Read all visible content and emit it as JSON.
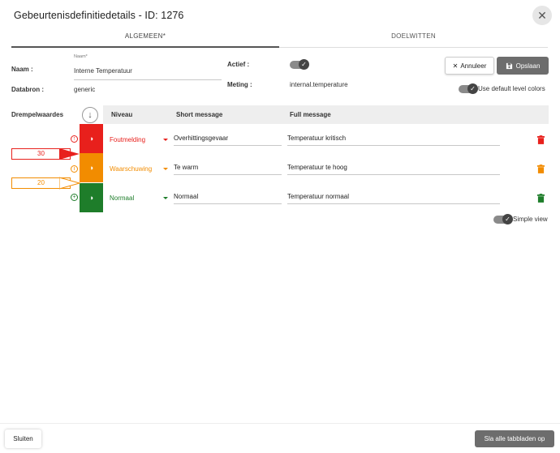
{
  "dialog": {
    "title": "Gebeurtenisdefinitiedetails - ID: 1276",
    "close_icon": "close-icon"
  },
  "tabs": [
    {
      "label": "ALGEMEEN*",
      "active": true
    },
    {
      "label": "DOELWITTEN",
      "active": false
    }
  ],
  "form": {
    "name_label": "Naam :",
    "name_floating_label": "Naam*",
    "name_value": "Interne Temperatuur",
    "source_label": "Databron :",
    "source_value": "generic",
    "active_label": "Actief :",
    "active_on": true,
    "metric_label": "Meting :",
    "metric_value": "internal.temperature",
    "default_colors_label": "Use default level colors",
    "default_colors_on": true
  },
  "actions": {
    "cancel_label": "Annuleer",
    "save_label": "Opslaan"
  },
  "thresholds": {
    "section_label": "Drempelwaardes",
    "columns": {
      "level": "Niveau",
      "short": "Short message",
      "full": "Full message"
    },
    "rows": [
      {
        "level": "Foutmelding",
        "color": "#e8201c",
        "short": "Overhittingsgevaar",
        "full": "Temperatuur kritisch"
      },
      {
        "level": "Waarschuwing",
        "color": "#f28c00",
        "short": "Te warm",
        "full": "Temperatuur te hoog"
      },
      {
        "level": "Normaal",
        "color": "#1e7d2a",
        "short": "Normaal",
        "full": "Temperatuur normaal"
      }
    ],
    "values": [
      {
        "value": "30",
        "color": "#e8201c"
      },
      {
        "value": "20",
        "color": "#f28c00"
      }
    ],
    "simple_view_label": "Simple view",
    "simple_view_on": true
  },
  "footer": {
    "close_label": "Sluiten",
    "save_all_label": "Sla alle tabbladen op"
  }
}
